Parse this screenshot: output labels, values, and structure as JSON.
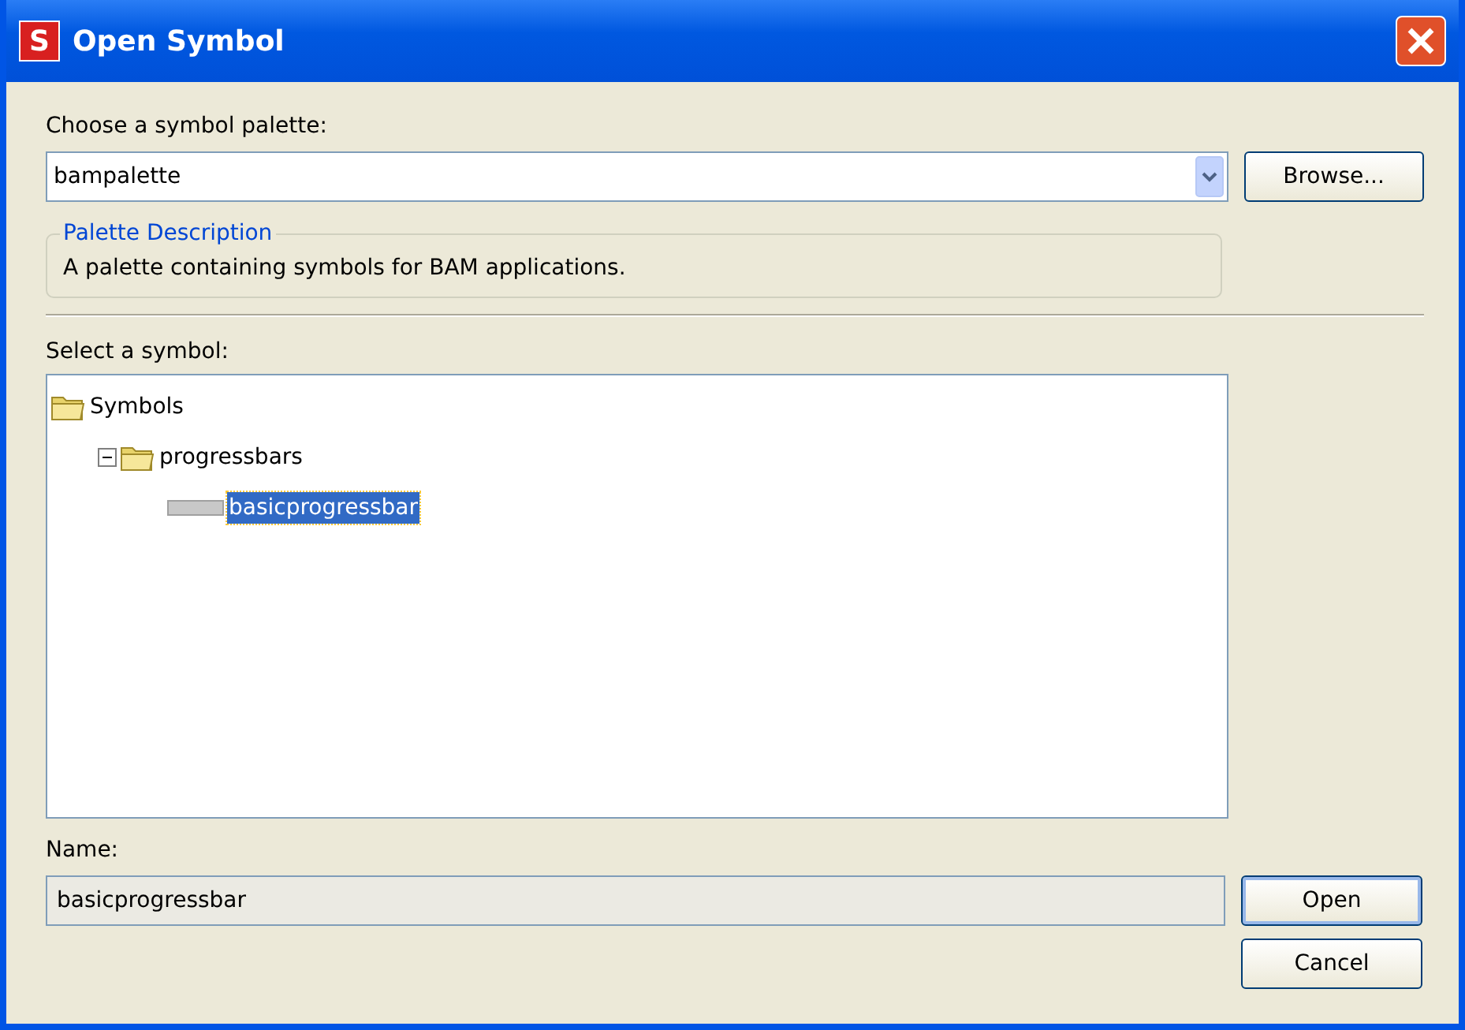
{
  "window": {
    "title": "Open Symbol",
    "app_icon_letter": "S"
  },
  "palette": {
    "label": "Choose a symbol palette:",
    "value": "bampalette",
    "browse_button": "Browse..."
  },
  "description": {
    "legend": "Palette Description",
    "text": "A palette containing symbols for BAM applications."
  },
  "tree": {
    "label": "Select a symbol:",
    "items": [
      {
        "label": "Symbols",
        "kind": "folder",
        "selected": false,
        "children": [
          {
            "label": "progressbars",
            "kind": "folder",
            "selected": false,
            "expanded": true,
            "children": [
              {
                "label": "basicprogressbar",
                "kind": "symbol",
                "selected": true
              }
            ]
          }
        ]
      }
    ]
  },
  "name": {
    "label": "Name:",
    "value": "basicprogressbar"
  },
  "buttons": [
    {
      "label": "Open",
      "default": true
    },
    {
      "label": "Cancel",
      "default": false
    }
  ]
}
